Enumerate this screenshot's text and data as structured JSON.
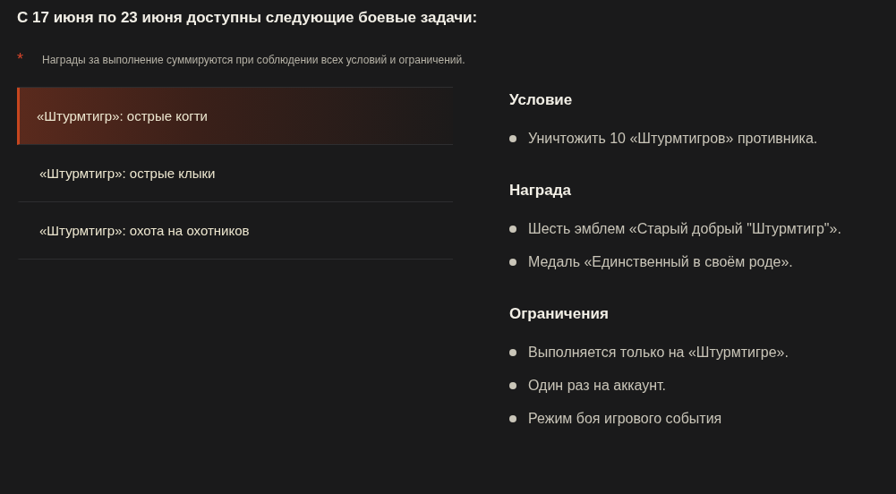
{
  "heading": "С 17 июня по 23 июня доступны следующие боевые задачи:",
  "note": {
    "mark": "*",
    "text": "Награды за выполнение суммируются при соблюдении всех условий и ограничений."
  },
  "tasks": [
    {
      "label": "«Штурмтигр»: острые когти",
      "selected": true
    },
    {
      "label": "«Штурмтигр»: острые клыки",
      "selected": false
    },
    {
      "label": "«Штурмтигр»: охота на охотников",
      "selected": false
    }
  ],
  "sections": [
    {
      "title": "Условие",
      "items": [
        "Уничтожить 10 «Штурмтигров» противника."
      ]
    },
    {
      "title": "Награда",
      "items": [
        "Шесть эмблем «Старый добрый \"Штурмтигр\"».",
        "Медаль «Единственный в своём роде»."
      ]
    },
    {
      "title": "Ограничения",
      "items": [
        "Выполняется только на «Штурмтигре».",
        "Один раз на аккаунт.",
        "Режим боя игрового события"
      ]
    }
  ]
}
